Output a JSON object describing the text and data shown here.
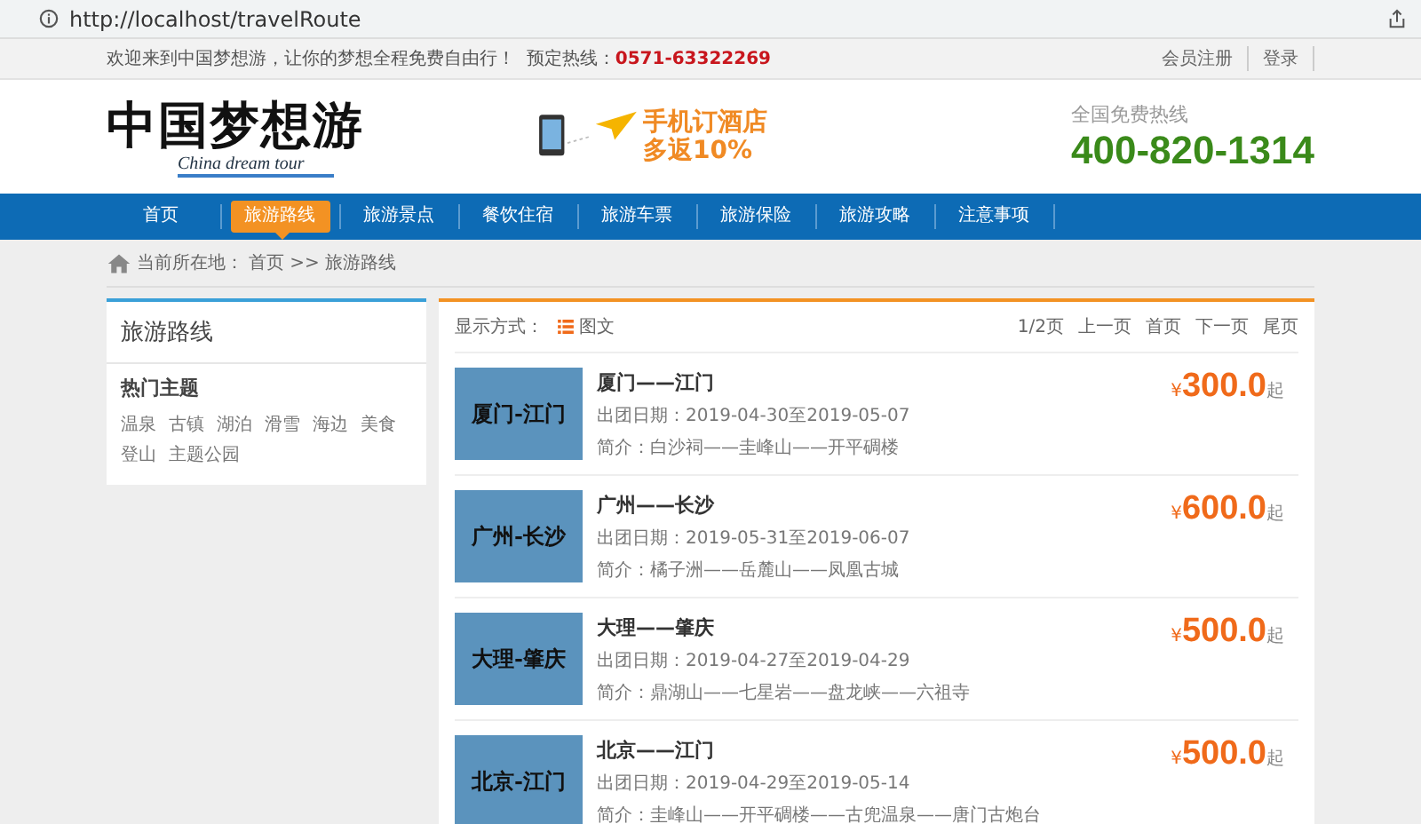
{
  "browser": {
    "url": "http://localhost/travelRoute"
  },
  "top_bar": {
    "welcome": "欢迎来到中国梦想游，让你的梦想全程免费自由行！",
    "hotline_label": "预定热线：",
    "hotline": "0571-63322269",
    "links": [
      "会员注册",
      "登录"
    ]
  },
  "header": {
    "logo": "中国梦想游",
    "logo_subtitle": "China dream tour",
    "ad_line_1": "手机订酒店",
    "ad_line_2": "多返10%",
    "free_hotline_label": "全国免费热线",
    "free_hotline": "400-820-1314"
  },
  "nav": [
    {
      "label": "首页",
      "selected": false
    },
    {
      "label": "旅游路线",
      "selected": true
    },
    {
      "label": "旅游景点",
      "selected": false
    },
    {
      "label": "餐饮住宿",
      "selected": false
    },
    {
      "label": "旅游车票",
      "selected": false
    },
    {
      "label": "旅游保险",
      "selected": false
    },
    {
      "label": "旅游攻略",
      "selected": false
    },
    {
      "label": "注意事项",
      "selected": false
    }
  ],
  "breadcrumb": {
    "label": "当前所在地：",
    "path": "首页 >> 旅游路线"
  },
  "sidebar": {
    "title": "旅游路线",
    "section": "热门主题",
    "tags": [
      "温泉",
      "古镇",
      "湖泊",
      "滑雪",
      "海边",
      "美食",
      "登山",
      "主题公园"
    ]
  },
  "list_bar": {
    "display_label": "显示方式：",
    "display_mode": "图文",
    "pager": [
      "1/2页",
      "上一页",
      "首页",
      "下一页",
      "尾页"
    ]
  },
  "routes": [
    {
      "thumb_text": "厦门-江门",
      "title": "厦门——江门",
      "dates": "出团日期：2019-04-30至2019-05-07",
      "intro": "简介：白沙祠——圭峰山——开平碉楼",
      "currency": "¥",
      "price": "300.0",
      "suffix": "起"
    },
    {
      "thumb_text": "广州-长沙",
      "title": "广州——长沙",
      "dates": "出团日期：2019-05-31至2019-06-07",
      "intro": "简介：橘子洲——岳麓山——凤凰古城",
      "currency": "¥",
      "price": "600.0",
      "suffix": "起"
    },
    {
      "thumb_text": "大理-肇庆",
      "title": "大理——肇庆",
      "dates": "出团日期：2019-04-27至2019-04-29",
      "intro": "简介：鼎湖山——七星岩——盘龙峡——六祖寺",
      "currency": "¥",
      "price": "500.0",
      "suffix": "起"
    },
    {
      "thumb_text": "北京-江门",
      "title": "北京——江门",
      "dates": "出团日期：2019-04-29至2019-05-14",
      "intro": "简介：圭峰山——开平碉楼——古兜温泉——唐门古炮台",
      "currency": "¥",
      "price": "500.0",
      "suffix": "起"
    }
  ]
}
